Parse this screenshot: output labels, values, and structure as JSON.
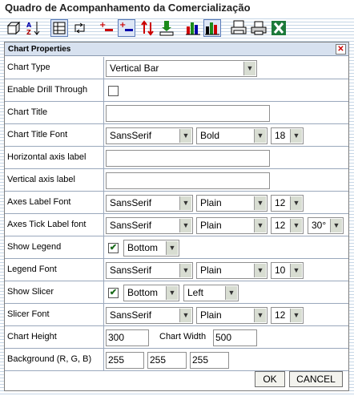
{
  "window": {
    "title": "Quadro de Acompanhamento da Comercialização"
  },
  "toolbar": {
    "icons": [
      "cube-icon",
      "sort-az-icon",
      "table-toggle-icon",
      "swap-axes-icon",
      "expand-minus-icon",
      "collapse-minus-icon",
      "sort-arrows-icon",
      "export-down-icon",
      "bar-chart-icon",
      "chart-properties-icon",
      "print-setup-icon",
      "print-icon",
      "excel-icon"
    ]
  },
  "panel": {
    "title": "Chart Properties",
    "close_symbol": "✕",
    "fields": {
      "chart_type": {
        "label": "Chart Type",
        "value": "Vertical Bar"
      },
      "drill_through": {
        "label": "Enable Drill Through",
        "checked": false
      },
      "chart_title": {
        "label": "Chart Title",
        "value": ""
      },
      "chart_title_font": {
        "label": "Chart Title Font",
        "family": "SansSerif",
        "style": "Bold",
        "size": "18"
      },
      "h_axis_label": {
        "label": "Horizontal axis label",
        "value": ""
      },
      "v_axis_label": {
        "label": "Vertical axis label",
        "value": ""
      },
      "axes_label_font": {
        "label": "Axes Label Font",
        "family": "SansSerif",
        "style": "Plain",
        "size": "12"
      },
      "axes_tick_font": {
        "label": "Axes Tick Label font",
        "family": "SansSerif",
        "style": "Plain",
        "size": "12",
        "rotation": "30°"
      },
      "show_legend": {
        "label": "Show Legend",
        "checked": true,
        "position": "Bottom"
      },
      "legend_font": {
        "label": "Legend Font",
        "family": "SansSerif",
        "style": "Plain",
        "size": "10"
      },
      "show_slicer": {
        "label": "Show Slicer",
        "checked": true,
        "position": "Bottom",
        "align": "Left"
      },
      "slicer_font": {
        "label": "Slicer Font",
        "family": "SansSerif",
        "style": "Plain",
        "size": "12"
      },
      "chart_height": {
        "label": "Chart Height",
        "value": "300"
      },
      "chart_width": {
        "label": "Chart Width",
        "value": "500"
      },
      "background": {
        "label": "Background (R, G, B)",
        "r": "255",
        "g": "255",
        "b": "255"
      }
    },
    "buttons": {
      "ok": "OK",
      "cancel": "CANCEL"
    },
    "check_symbol": "✔",
    "dropdown_arrow": "▼"
  }
}
